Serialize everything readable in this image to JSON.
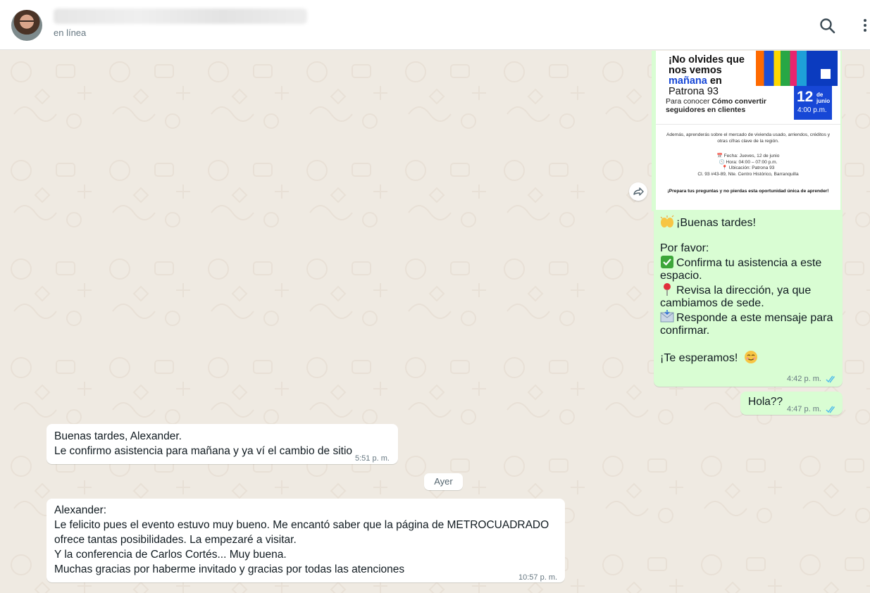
{
  "header": {
    "status": "en línea",
    "icons": {
      "search": "search-icon",
      "menu": "kebab-menu-icon",
      "avatar": "contact-avatar"
    }
  },
  "flyer": {
    "headline_line1": "¡No olvides que",
    "headline_line2": "nos vemos",
    "headline_line3_blue": "mañana",
    "headline_line3_rest": " en",
    "headline_line4": "Patrona 93",
    "date_day": "12",
    "date_month": "de junio",
    "date_hour": "4:00 p.m.",
    "sub_prefix": "Para conocer ",
    "sub_bold": "Cómo convertir seguidores en clientes",
    "small_intro": "Además, aprenderás sobre el mercado de vivienda usado, arriendos, créditos y otras cifras clave de la región.",
    "fecha": "📅 Fecha: Jueves, 12 de junio",
    "hora": "🕓 Hora: 04:00 – 07:00 p.m.",
    "ubicacion": "📍 Ubicación: Patrona 93",
    "direccion": "Cl. 93 #43-89, Nte. Centro Histórico, Barranquilla",
    "cta": "¡Prepara tus preguntas y no pierdas esta oportunidad única de aprender!"
  },
  "messages": {
    "m1": {
      "line1": "¡Buenas tardes!",
      "line2": "Por favor:",
      "line3": "Confirma tu asistencia a este",
      "line4": "espacio.",
      "line5": "Revisa la dirección, ya que",
      "line6": "cambiamos de sede.",
      "line7": "Responde a este mensaje para",
      "line8": "confirmar.",
      "line9": "¡Te esperamos!",
      "time": "4:42 p. m."
    },
    "m2": {
      "text": "Hola??",
      "time": "4:47 p. m."
    },
    "m3": {
      "line1": "Buenas tardes, Alexander.",
      "line2": "Le confirmo asistencia para mañana y ya ví el cambio de sitio",
      "time": "5:51 p. m."
    },
    "day_separator": "Ayer",
    "m4": {
      "line1": "Alexander:",
      "line2": "Le felicito pues el evento estuvo muy bueno. Me encantó saber que la página de METROCUADRADO",
      "line3": "ofrece tantas posibilidades. La empezaré a visitar.",
      "line4": "Y la conferencia de Carlos Cortés... Muy buena.",
      "line5": "Muchas gracias por haberme invitado y gracias por todas las atenciones",
      "time": "10:57 p. m."
    }
  },
  "colors": {
    "outgoing_bubble": "#d9fdd3",
    "incoming_bubble": "#ffffff",
    "chat_background": "#efeae2",
    "read_ticks": "#53bdeb"
  }
}
